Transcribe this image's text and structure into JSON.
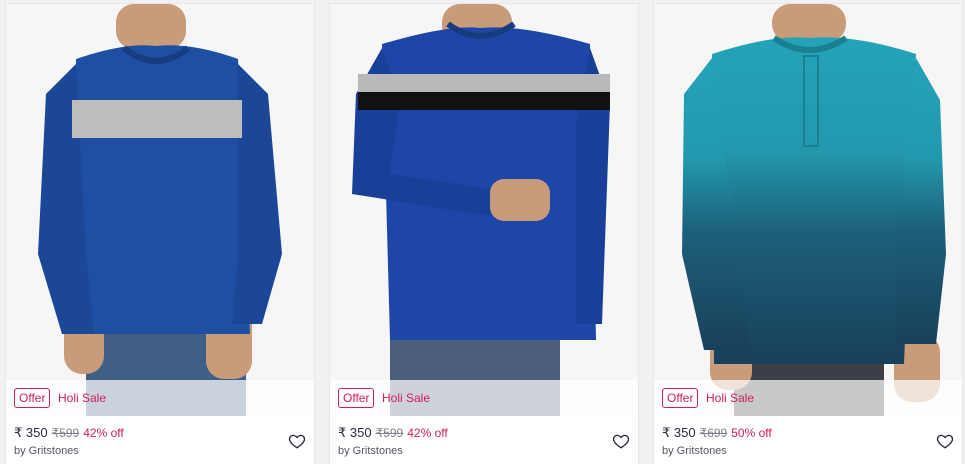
{
  "products": [
    {
      "offer_label": "Offer",
      "sale_label": "Holi Sale",
      "price": "₹ 350",
      "mrp": "₹599",
      "discount": "42% off",
      "brand": "by Gritstones",
      "image": {
        "color": "#1f4fa2",
        "stripe": "#bdbdbd"
      }
    },
    {
      "offer_label": "Offer",
      "sale_label": "Holi Sale",
      "price": "₹ 350",
      "mrp": "₹599",
      "discount": "42% off",
      "brand": "by Gritstones",
      "image": {
        "color": "#1d46a8",
        "stripe": "#b9b9b9",
        "stripe2": "#111111"
      }
    },
    {
      "offer_label": "Offer",
      "sale_label": "Holi Sale",
      "price": "₹ 350",
      "mrp": "₹699",
      "discount": "50% off",
      "brand": "by Gritstones",
      "image": {
        "color_top": "#24a3b8",
        "color_bottom": "#19405a"
      }
    }
  ],
  "icons": {
    "wishlist": "heart-outline-icon"
  },
  "colors": {
    "accent": "#cf1d58",
    "text": "#282c3f",
    "muted": "#7e818c"
  }
}
